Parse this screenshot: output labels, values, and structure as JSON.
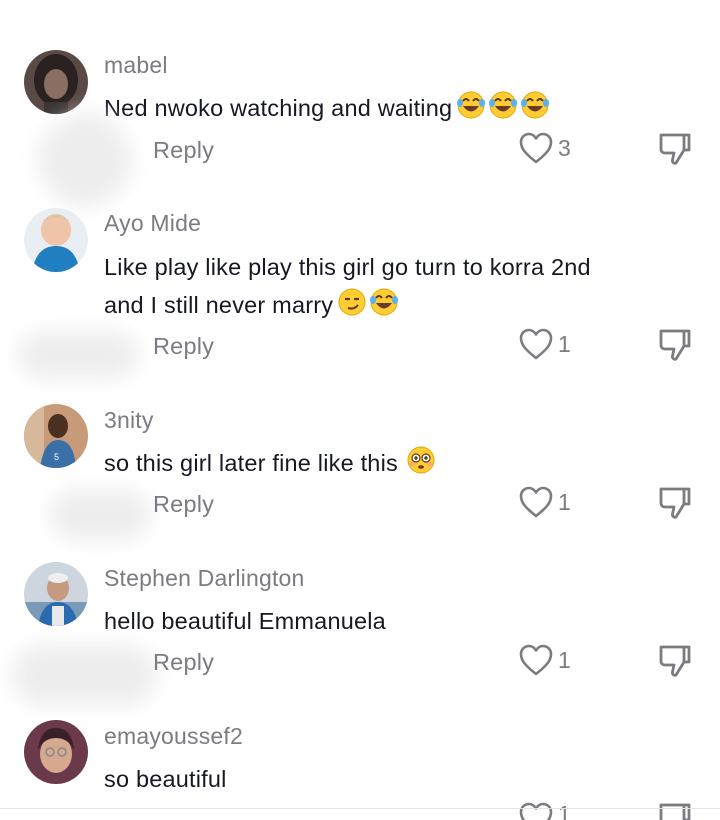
{
  "reply_label": "Reply",
  "comments": [
    {
      "username": "mabel",
      "text": "Ned nwoko watching and waiting",
      "emoji": [
        "laughing-tears",
        "laughing-tears",
        "laughing-tears"
      ],
      "likes": "3"
    },
    {
      "username": "Ayo Mide",
      "text": "Like play like play this girl go turn to korra 2nd and I still never marry",
      "emoji": [
        "smirk",
        "laughing-tears"
      ],
      "likes": "1"
    },
    {
      "username": "3nity",
      "text": "so this girl later fine like this",
      "emoji": [
        "flushed"
      ],
      "likes": "1"
    },
    {
      "username": "Stephen Darlington",
      "text": "hello beautiful Emmanuela",
      "emoji": [],
      "likes": "1"
    },
    {
      "username": "emayoussef2",
      "text": "so beautiful",
      "emoji": [],
      "likes": "1"
    }
  ],
  "colors": {
    "username": "#7b7b82",
    "text": "#161823",
    "icon": "#7b7b82"
  }
}
